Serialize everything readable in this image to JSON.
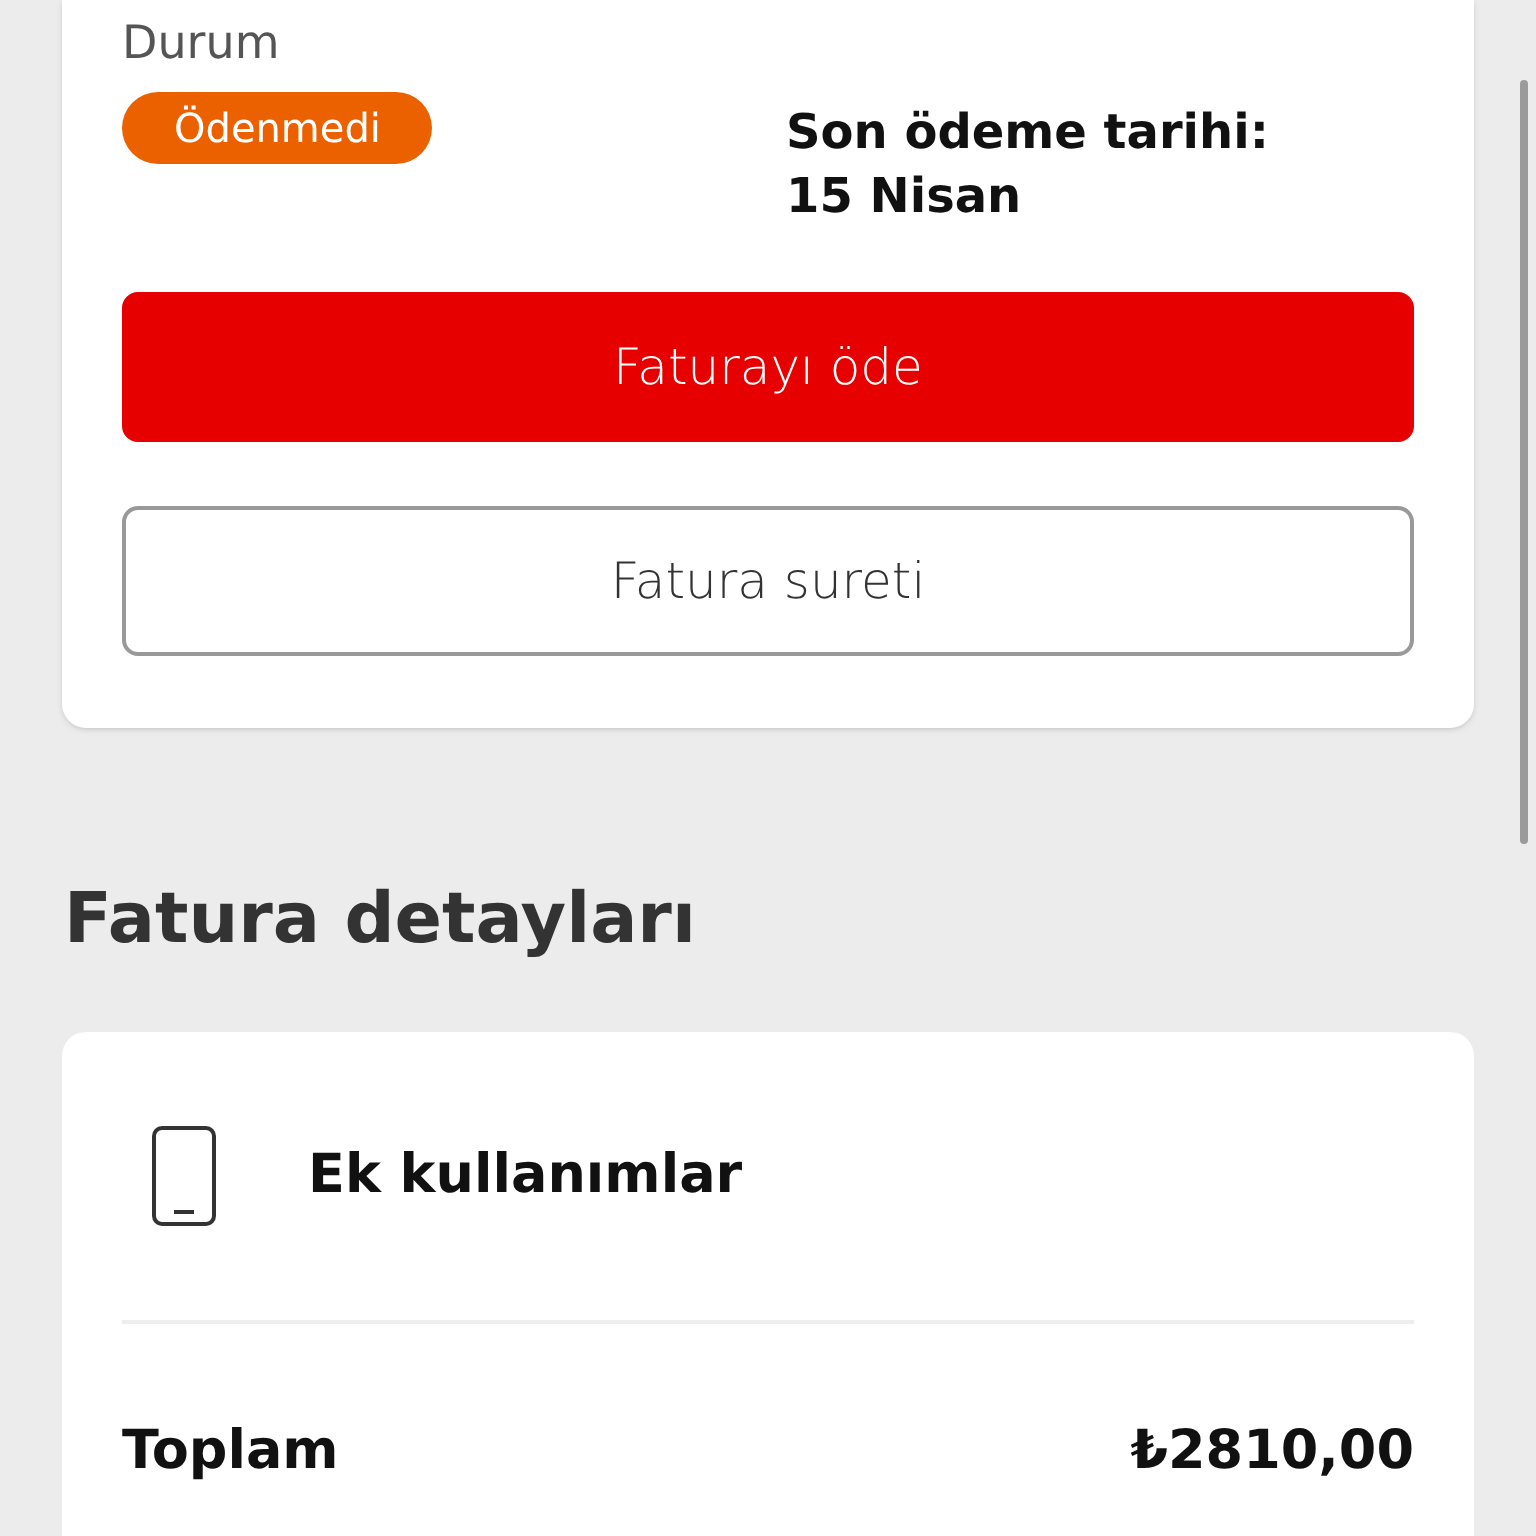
{
  "status_card": {
    "status_label": "Durum",
    "status_badge": "Ödenmedi",
    "due_date_label": "Son ödeme tarihi:",
    "due_date": "15 Nisan",
    "buttons": [
      {
        "kind": "primary",
        "label": "Faturayı öde"
      },
      {
        "kind": "outline",
        "label": "Fatura sureti"
      }
    ]
  },
  "details": {
    "heading": "Fatura detayları",
    "item": "Ek kullanımlar",
    "total_label": "Toplam",
    "total_value": "₺2810,00"
  }
}
